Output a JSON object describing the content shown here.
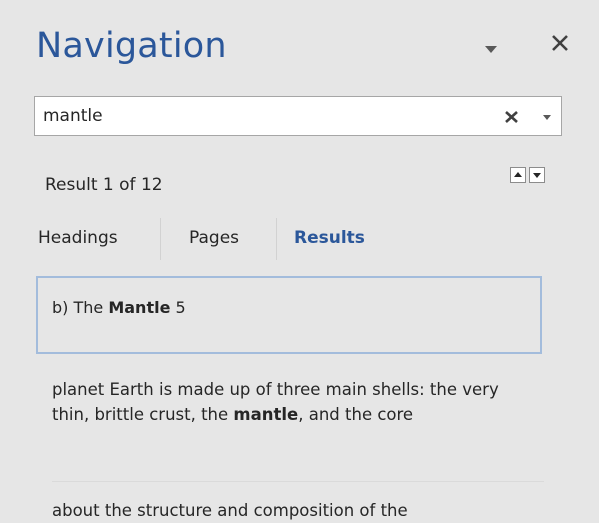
{
  "pane": {
    "title": "Navigation",
    "menu_icon": "chevron-down-icon",
    "close_icon": "close-icon"
  },
  "search": {
    "value": "mantle",
    "clear_icon": "clear-icon",
    "dropdown_icon": "chevron-down-icon"
  },
  "results_nav": {
    "count_text": "Result 1 of 12",
    "prev_icon": "arrow-up-icon",
    "next_icon": "arrow-down-icon"
  },
  "tabs": [
    {
      "label": "Headings",
      "active": false
    },
    {
      "label": "Pages",
      "active": false
    },
    {
      "label": "Results",
      "active": true
    }
  ],
  "results": {
    "selected_heading": {
      "prefix": "b) The ",
      "match": "Mantle",
      "suffix": " 5"
    },
    "snippets": [
      {
        "before": "planet Earth is made up of three main shells: the very thin, brittle crust, the ",
        "match": "mantle",
        "after": ", and the core"
      },
      {
        "before": "about the structure and composition of the",
        "match": "",
        "after": ""
      }
    ]
  },
  "colors": {
    "accent": "#2b579a",
    "background": "#e6e6e6",
    "selection_border": "#a3bcdc"
  }
}
